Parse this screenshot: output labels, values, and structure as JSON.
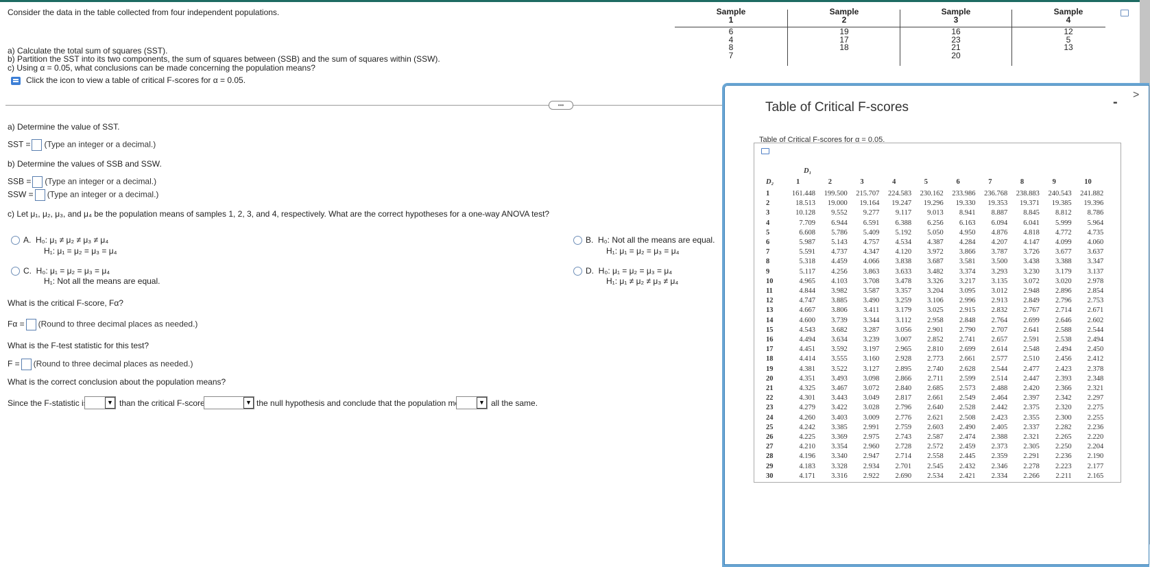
{
  "problem": {
    "intro": "Consider the data in the table collected from four independent populations.",
    "part_a": "a) Calculate the total sum of squares (SST).",
    "part_b": "b) Partition the SST into its two components, the sum of squares between (SSB) and the sum of squares within (SSW).",
    "part_c": "c) Using α = 0.05, what conclusions can be made concerning the population means?",
    "icon_link": "Click the icon to view a table of critical F-scores for α = 0.05."
  },
  "data_table": {
    "headers": [
      [
        "Sample",
        "1"
      ],
      [
        "Sample",
        "2"
      ],
      [
        "Sample",
        "3"
      ],
      [
        "Sample",
        "4"
      ]
    ],
    "columns": [
      [
        "6",
        "4",
        "8",
        "7"
      ],
      [
        "19",
        "17",
        "18"
      ],
      [
        "16",
        "23",
        "21",
        "20"
      ],
      [
        "12",
        "5",
        "13"
      ]
    ]
  },
  "more_button": "•••",
  "answers": {
    "a_title": "a) Determine the value of SST.",
    "sst_label": "SST =",
    "sst_hint": "(Type an integer or a decimal.)",
    "b_title": "b) Determine the values of SSB and SSW.",
    "ssb_label": "SSB =",
    "ssb_hint": "(Type an integer or a decimal.)",
    "ssw_label": "SSW =",
    "ssw_hint": "(Type an integer or a decimal.)",
    "c_title": "c) Let μ₁, μ₂, μ₃, and μ₄ be the population means of samples 1, 2, 3, and 4, respectively. What are the correct hypotheses for a one-way ANOVA test?",
    "options": [
      {
        "letter": "A.",
        "h0": "H₀: μ₁ ≠ μ₂ ≠ μ₃ ≠ μ₄",
        "h1": "H₁: μ₁ = μ₂ = μ₃ = μ₄"
      },
      {
        "letter": "B.",
        "h0": "H₀: Not all the means are equal.",
        "h1": "H₁: μ₁ = μ₂ = μ₃ = μ₄"
      },
      {
        "letter": "C.",
        "h0": "H₀: μ₁ = μ₂ = μ₃ = μ₄",
        "h1": "H₁: Not all the means are equal."
      },
      {
        "letter": "D.",
        "h0": "H₀: μ₁ = μ₂ = μ₃ = μ₄",
        "h1": "H₁: μ₁ ≠ μ₂ ≠ μ₃ ≠ μ₄"
      }
    ],
    "crit_question": "What is the critical F-score, Fα?",
    "falpha_label": "Fα =",
    "falpha_hint": "(Round to three decimal places as needed.)",
    "ftest_question": "What is the F-test statistic for this test?",
    "f_label": "F =",
    "f_hint": "(Round to three decimal places as needed.)",
    "conclusion_question": "What is the correct conclusion about the population means?",
    "sentence_1": "Since the F-statistic is",
    "sentence_2": "than the critical F-score,",
    "sentence_3": "the null hypothesis and conclude that the population means",
    "sentence_4": "all the same.",
    "dropdown_1": "",
    "dropdown_2": "",
    "dropdown_3": ""
  },
  "popup": {
    "title": "Table of Critical F-scores",
    "minimize": "-",
    "next": ">",
    "subtitle": "Table of Critical F-scores for α = 0.05.",
    "d1_label": "D₁",
    "d2_label": "D₂",
    "columns": [
      "1",
      "2",
      "3",
      "4",
      "5",
      "6",
      "7",
      "8",
      "9",
      "10"
    ],
    "rows": [
      [
        "1",
        "161.448",
        "199.500",
        "215.707",
        "224.583",
        "230.162",
        "233.986",
        "236.768",
        "238.883",
        "240.543",
        "241.882"
      ],
      [
        "2",
        "18.513",
        "19.000",
        "19.164",
        "19.247",
        "19.296",
        "19.330",
        "19.353",
        "19.371",
        "19.385",
        "19.396"
      ],
      [
        "3",
        "10.128",
        "9.552",
        "9.277",
        "9.117",
        "9.013",
        "8.941",
        "8.887",
        "8.845",
        "8.812",
        "8.786"
      ],
      [
        "4",
        "7.709",
        "6.944",
        "6.591",
        "6.388",
        "6.256",
        "6.163",
        "6.094",
        "6.041",
        "5.999",
        "5.964"
      ],
      [
        "5",
        "6.608",
        "5.786",
        "5.409",
        "5.192",
        "5.050",
        "4.950",
        "4.876",
        "4.818",
        "4.772",
        "4.735"
      ],
      [
        "6",
        "5.987",
        "5.143",
        "4.757",
        "4.534",
        "4.387",
        "4.284",
        "4.207",
        "4.147",
        "4.099",
        "4.060"
      ],
      [
        "7",
        "5.591",
        "4.737",
        "4.347",
        "4.120",
        "3.972",
        "3.866",
        "3.787",
        "3.726",
        "3.677",
        "3.637"
      ],
      [
        "8",
        "5.318",
        "4.459",
        "4.066",
        "3.838",
        "3.687",
        "3.581",
        "3.500",
        "3.438",
        "3.388",
        "3.347"
      ],
      [
        "9",
        "5.117",
        "4.256",
        "3.863",
        "3.633",
        "3.482",
        "3.374",
        "3.293",
        "3.230",
        "3.179",
        "3.137"
      ],
      [
        "10",
        "4.965",
        "4.103",
        "3.708",
        "3.478",
        "3.326",
        "3.217",
        "3.135",
        "3.072",
        "3.020",
        "2.978"
      ],
      [
        "11",
        "4.844",
        "3.982",
        "3.587",
        "3.357",
        "3.204",
        "3.095",
        "3.012",
        "2.948",
        "2.896",
        "2.854"
      ],
      [
        "12",
        "4.747",
        "3.885",
        "3.490",
        "3.259",
        "3.106",
        "2.996",
        "2.913",
        "2.849",
        "2.796",
        "2.753"
      ],
      [
        "13",
        "4.667",
        "3.806",
        "3.411",
        "3.179",
        "3.025",
        "2.915",
        "2.832",
        "2.767",
        "2.714",
        "2.671"
      ],
      [
        "14",
        "4.600",
        "3.739",
        "3.344",
        "3.112",
        "2.958",
        "2.848",
        "2.764",
        "2.699",
        "2.646",
        "2.602"
      ],
      [
        "15",
        "4.543",
        "3.682",
        "3.287",
        "3.056",
        "2.901",
        "2.790",
        "2.707",
        "2.641",
        "2.588",
        "2.544"
      ],
      [
        "16",
        "4.494",
        "3.634",
        "3.239",
        "3.007",
        "2.852",
        "2.741",
        "2.657",
        "2.591",
        "2.538",
        "2.494"
      ],
      [
        "17",
        "4.451",
        "3.592",
        "3.197",
        "2.965",
        "2.810",
        "2.699",
        "2.614",
        "2.548",
        "2.494",
        "2.450"
      ],
      [
        "18",
        "4.414",
        "3.555",
        "3.160",
        "2.928",
        "2.773",
        "2.661",
        "2.577",
        "2.510",
        "2.456",
        "2.412"
      ],
      [
        "19",
        "4.381",
        "3.522",
        "3.127",
        "2.895",
        "2.740",
        "2.628",
        "2.544",
        "2.477",
        "2.423",
        "2.378"
      ],
      [
        "20",
        "4.351",
        "3.493",
        "3.098",
        "2.866",
        "2.711",
        "2.599",
        "2.514",
        "2.447",
        "2.393",
        "2.348"
      ],
      [
        "21",
        "4.325",
        "3.467",
        "3.072",
        "2.840",
        "2.685",
        "2.573",
        "2.488",
        "2.420",
        "2.366",
        "2.321"
      ],
      [
        "22",
        "4.301",
        "3.443",
        "3.049",
        "2.817",
        "2.661",
        "2.549",
        "2.464",
        "2.397",
        "2.342",
        "2.297"
      ],
      [
        "23",
        "4.279",
        "3.422",
        "3.028",
        "2.796",
        "2.640",
        "2.528",
        "2.442",
        "2.375",
        "2.320",
        "2.275"
      ],
      [
        "24",
        "4.260",
        "3.403",
        "3.009",
        "2.776",
        "2.621",
        "2.508",
        "2.423",
        "2.355",
        "2.300",
        "2.255"
      ],
      [
        "25",
        "4.242",
        "3.385",
        "2.991",
        "2.759",
        "2.603",
        "2.490",
        "2.405",
        "2.337",
        "2.282",
        "2.236"
      ],
      [
        "26",
        "4.225",
        "3.369",
        "2.975",
        "2.743",
        "2.587",
        "2.474",
        "2.388",
        "2.321",
        "2.265",
        "2.220"
      ],
      [
        "27",
        "4.210",
        "3.354",
        "2.960",
        "2.728",
        "2.572",
        "2.459",
        "2.373",
        "2.305",
        "2.250",
        "2.204"
      ],
      [
        "28",
        "4.196",
        "3.340",
        "2.947",
        "2.714",
        "2.558",
        "2.445",
        "2.359",
        "2.291",
        "2.236",
        "2.190"
      ],
      [
        "29",
        "4.183",
        "3.328",
        "2.934",
        "2.701",
        "2.545",
        "2.432",
        "2.346",
        "2.278",
        "2.223",
        "2.177"
      ],
      [
        "30",
        "4.171",
        "3.316",
        "2.922",
        "2.690",
        "2.534",
        "2.421",
        "2.334",
        "2.266",
        "2.211",
        "2.165"
      ]
    ]
  },
  "colors": {
    "topbar": "#1e6b63",
    "accent": "#3d7fd6",
    "popup_border": "#6aa6d4"
  }
}
